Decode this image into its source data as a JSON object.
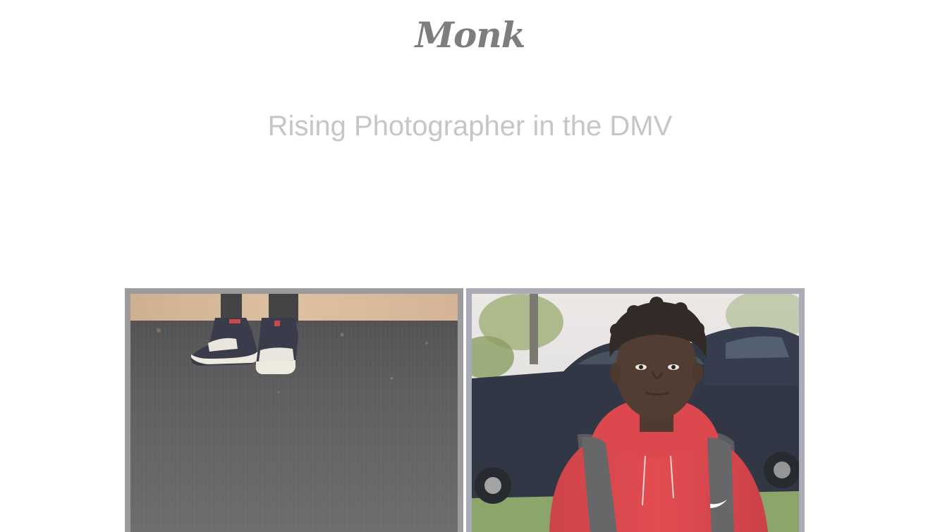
{
  "header": {
    "logo_text": "Monk",
    "tagline": "Rising Photographer in the DMV"
  },
  "gallery": {
    "photos": [
      {
        "subject": "sneakers-on-asphalt-photo"
      },
      {
        "subject": "portrait-red-hoodie-photo"
      }
    ]
  },
  "colors": {
    "logo": "#7d7d7d",
    "tagline": "#c6c6c6",
    "frame_left": "#9b9b9b",
    "frame_right": "#a9abb8"
  }
}
